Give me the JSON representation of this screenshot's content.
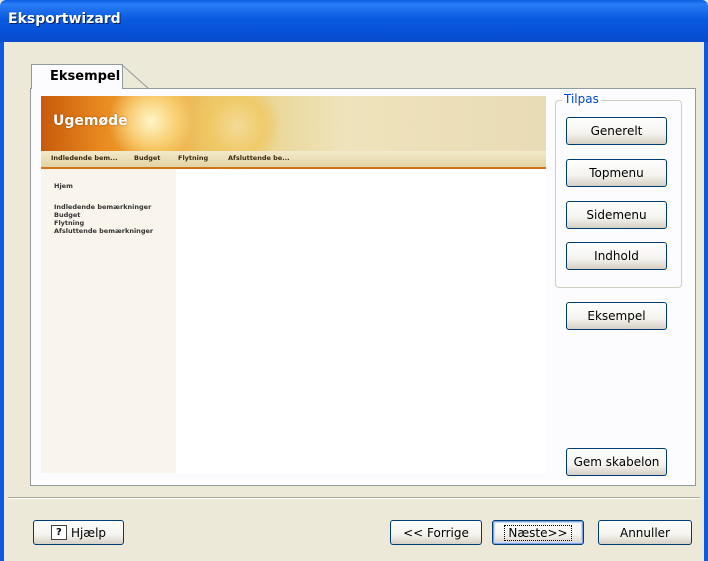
{
  "window": {
    "title": "Eksportwizard"
  },
  "tab": {
    "label": "Eksempel"
  },
  "preview": {
    "banner_title": "Ugemøde",
    "nav_items": [
      "Indledende bem...",
      "Budget",
      "Flytning",
      "Afsluttende be..."
    ],
    "sidebar_items": [
      "Hjem",
      "Indledende bemærkninger",
      "Budget",
      "Flytning",
      "Afsluttende bemærkninger"
    ]
  },
  "customize": {
    "group_label": "Tilpas",
    "buttons": [
      "Generelt",
      "Topmenu",
      "Sidemenu",
      "Indhold"
    ]
  },
  "preview_button": "Eksempel",
  "save_template_button": "Gem skabelon",
  "footer": {
    "help": "Hjælp",
    "back": "<< Forrige",
    "next": "Næste>>",
    "cancel": "Annuller"
  }
}
